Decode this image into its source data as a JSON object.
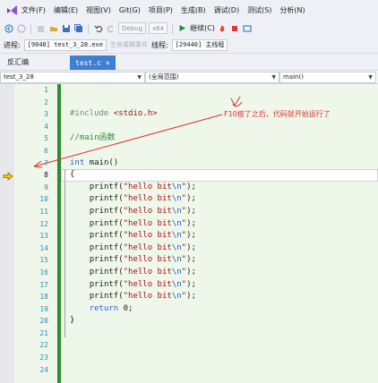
{
  "menubar": {
    "items": [
      "文件(F)",
      "编辑(E)",
      "视图(V)",
      "Git(G)",
      "项目(P)",
      "生成(B)",
      "调试(D)",
      "测试(S)",
      "分析(N)"
    ]
  },
  "toolbar": {
    "config": "Debug",
    "platform": "x64",
    "continue_label": "继续(C)"
  },
  "processbar": {
    "process_label": "进程:",
    "process_value": "[9048] test_3_28.exe",
    "lifecycle_label": "生命周期事件",
    "thread_label": "线程:",
    "thread_value": "[29440] 主线程"
  },
  "tabs": {
    "disassembly": "反汇编",
    "active_file": "test.c",
    "active_close": "×"
  },
  "navbar": {
    "project": "test_3_28",
    "scope": "(全局范围)",
    "function": "main()"
  },
  "annotation": {
    "text": "F10按了之后，代码就开始运行了"
  },
  "editor": {
    "current_line": 8,
    "lines": [
      {
        "n": "1"
      },
      {
        "n": "2"
      },
      {
        "n": "3",
        "pp": "#include ",
        "inc": "<stdio.h>"
      },
      {
        "n": "4"
      },
      {
        "n": "5",
        "cm": "//main函数"
      },
      {
        "n": "6"
      },
      {
        "n": "7",
        "kw": "int",
        "rest": " main()"
      },
      {
        "n": "8",
        "rest": "{"
      },
      {
        "n": "9",
        "indent": "    ",
        "fn": "printf(",
        "str": "\"hello bit",
        "esc": "\\n",
        "str2": "\"",
        "end": ");"
      },
      {
        "n": "10",
        "indent": "    ",
        "fn": "printf(",
        "str": "\"hello bit",
        "esc": "\\n",
        "str2": "\"",
        "end": ");"
      },
      {
        "n": "11",
        "indent": "    ",
        "fn": "printf(",
        "str": "\"hello bit",
        "esc": "\\n",
        "str2": "\"",
        "end": ");"
      },
      {
        "n": "12",
        "indent": "    ",
        "fn": "printf(",
        "str": "\"hello bit",
        "esc": "\\n",
        "str2": "\"",
        "end": ");"
      },
      {
        "n": "13",
        "indent": "    ",
        "fn": "printf(",
        "str": "\"hello bit",
        "esc": "\\n",
        "str2": "\"",
        "end": ");"
      },
      {
        "n": "14",
        "indent": "    ",
        "fn": "printf(",
        "str": "\"hello bit",
        "esc": "\\n",
        "str2": "\"",
        "end": ");"
      },
      {
        "n": "15",
        "indent": "    ",
        "fn": "printf(",
        "str": "\"hello bit",
        "esc": "\\n",
        "str2": "\"",
        "end": ");"
      },
      {
        "n": "16",
        "indent": "    ",
        "fn": "printf(",
        "str": "\"hello bit",
        "esc": "\\n",
        "str2": "\"",
        "end": ");"
      },
      {
        "n": "17",
        "indent": "    ",
        "fn": "printf(",
        "str": "\"hello bit",
        "esc": "\\n",
        "str2": "\"",
        "end": ");"
      },
      {
        "n": "18",
        "indent": "    ",
        "fn": "printf(",
        "str": "\"hello bit",
        "esc": "\\n",
        "str2": "\"",
        "end": ");"
      },
      {
        "n": "19",
        "indent": "    ",
        "kw": "return",
        "rest": " 0;"
      },
      {
        "n": "20",
        "rest": "}"
      },
      {
        "n": "21"
      },
      {
        "n": "22"
      },
      {
        "n": "23"
      },
      {
        "n": "24"
      }
    ]
  },
  "colors": {
    "accent": "#3f7fd1",
    "change_bar": "#2e8b2e",
    "annotation": "#e03030"
  }
}
